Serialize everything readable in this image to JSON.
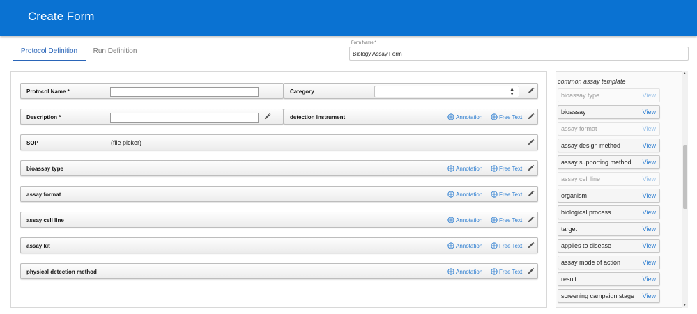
{
  "header": {
    "title": "Create Form"
  },
  "tabs": [
    {
      "label": "Protocol Definition",
      "active": true
    },
    {
      "label": "Run Definition",
      "active": false
    }
  ],
  "form_name": {
    "label": "Form Name *",
    "value": "Biology Assay Form"
  },
  "fields": {
    "protocol_name": {
      "label": "Protocol Name *",
      "value": ""
    },
    "category": {
      "label": "Category",
      "selected": ""
    },
    "description": {
      "label": "Description *",
      "value": ""
    },
    "detection_instrument": {
      "label": "detection instrument"
    },
    "sop": {
      "label": "SOP",
      "value": "(file picker)"
    },
    "bioassay_type": {
      "label": "bioassay type"
    },
    "assay_format": {
      "label": "assay format"
    },
    "assay_cell_line": {
      "label": "assay cell line"
    },
    "assay_kit": {
      "label": "assay kit"
    },
    "physical_detection_method": {
      "label": "physical detection method"
    }
  },
  "actions": {
    "annotation": "Annotation",
    "free_text": "Free Text"
  },
  "template": {
    "title": "common assay template",
    "view_label": "View",
    "items": [
      {
        "name": "bioassay type",
        "enabled": false
      },
      {
        "name": "bioassay",
        "enabled": true
      },
      {
        "name": "assay format",
        "enabled": false
      },
      {
        "name": "assay design method",
        "enabled": true
      },
      {
        "name": "assay supporting method",
        "enabled": true
      },
      {
        "name": "assay cell line",
        "enabled": false
      },
      {
        "name": "organism",
        "enabled": true
      },
      {
        "name": "biological process",
        "enabled": true
      },
      {
        "name": "target",
        "enabled": true
      },
      {
        "name": "applies to disease",
        "enabled": true
      },
      {
        "name": "assay mode of action",
        "enabled": true
      },
      {
        "name": "result",
        "enabled": true
      },
      {
        "name": "screening campaign stage",
        "enabled": true
      }
    ]
  },
  "colors": {
    "brand": "#0a72d2",
    "link": "#2f7fd1",
    "tab_active": "#2a65b8"
  },
  "icons": {
    "edit": "pencil-icon",
    "annotation": "globe-icon",
    "free_text": "globe-icon",
    "select": "up-down-arrows-icon"
  }
}
